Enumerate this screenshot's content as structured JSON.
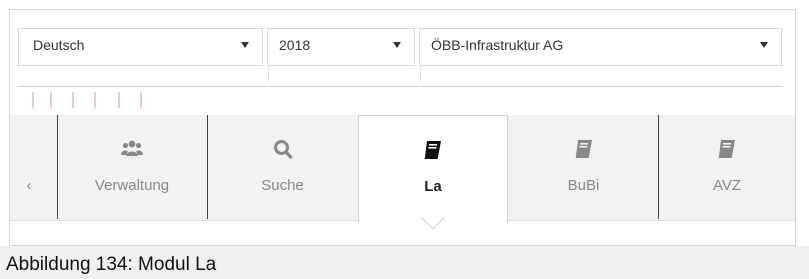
{
  "selects": {
    "language": "Deutsch",
    "year": "2018",
    "company": "ÖBB-Infrastruktur AG"
  },
  "tabs": [
    {
      "label": "‹",
      "icon": "chevron-left-icon"
    },
    {
      "label": "Verwaltung",
      "icon": "users-icon"
    },
    {
      "label": "Suche",
      "icon": "search-icon"
    },
    {
      "label": "La",
      "icon": "book-icon",
      "active": true
    },
    {
      "label": "BuBi",
      "icon": "book-icon"
    },
    {
      "label": "AVZ",
      "icon": "book-icon"
    }
  ],
  "caption": "Abbildung 134: Modul La",
  "colors": {
    "active_text": "#222222",
    "inactive_text": "#888888",
    "tab_background": "#f2f2f2",
    "tick_color": "#f1c8c6"
  }
}
